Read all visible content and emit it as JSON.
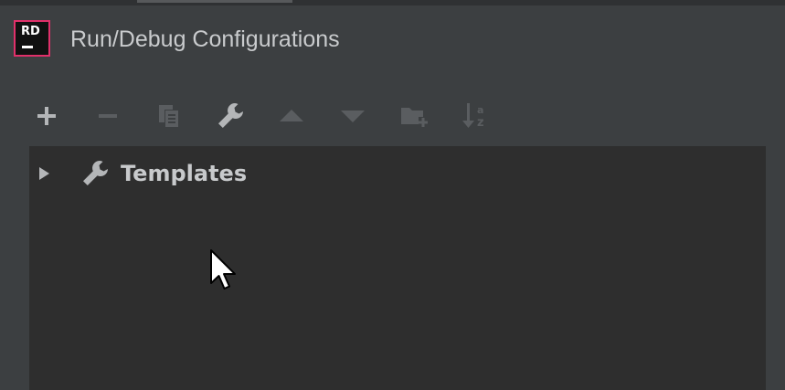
{
  "window": {
    "title": "Run/Debug Configurations",
    "logo_text": "RD"
  },
  "toolbar": {
    "buttons": [
      {
        "name": "add",
        "icon": "plus-icon",
        "enabled": true
      },
      {
        "name": "remove",
        "icon": "minus-icon",
        "enabled": false
      },
      {
        "name": "copy",
        "icon": "copy-icon",
        "enabled": false
      },
      {
        "name": "edit-templates",
        "icon": "wrench-icon",
        "enabled": true
      },
      {
        "name": "move-up",
        "icon": "triangle-up-icon",
        "enabled": false
      },
      {
        "name": "move-down",
        "icon": "triangle-down-icon",
        "enabled": false
      },
      {
        "name": "new-folder",
        "icon": "folder-add-icon",
        "enabled": false
      },
      {
        "name": "sort-alphabetically",
        "icon": "sort-az-icon",
        "enabled": false
      }
    ]
  },
  "tree": {
    "items": [
      {
        "label": "Templates",
        "icon": "wrench-icon",
        "expanded": false
      }
    ]
  },
  "colors": {
    "window_bg": "#3c3f41",
    "panel_bg": "#2e2e2e",
    "title_text": "#c9cbcd",
    "icon_enabled": "#b4b6b8",
    "icon_disabled": "#5a5d60",
    "logo_border": "#e0306a"
  }
}
